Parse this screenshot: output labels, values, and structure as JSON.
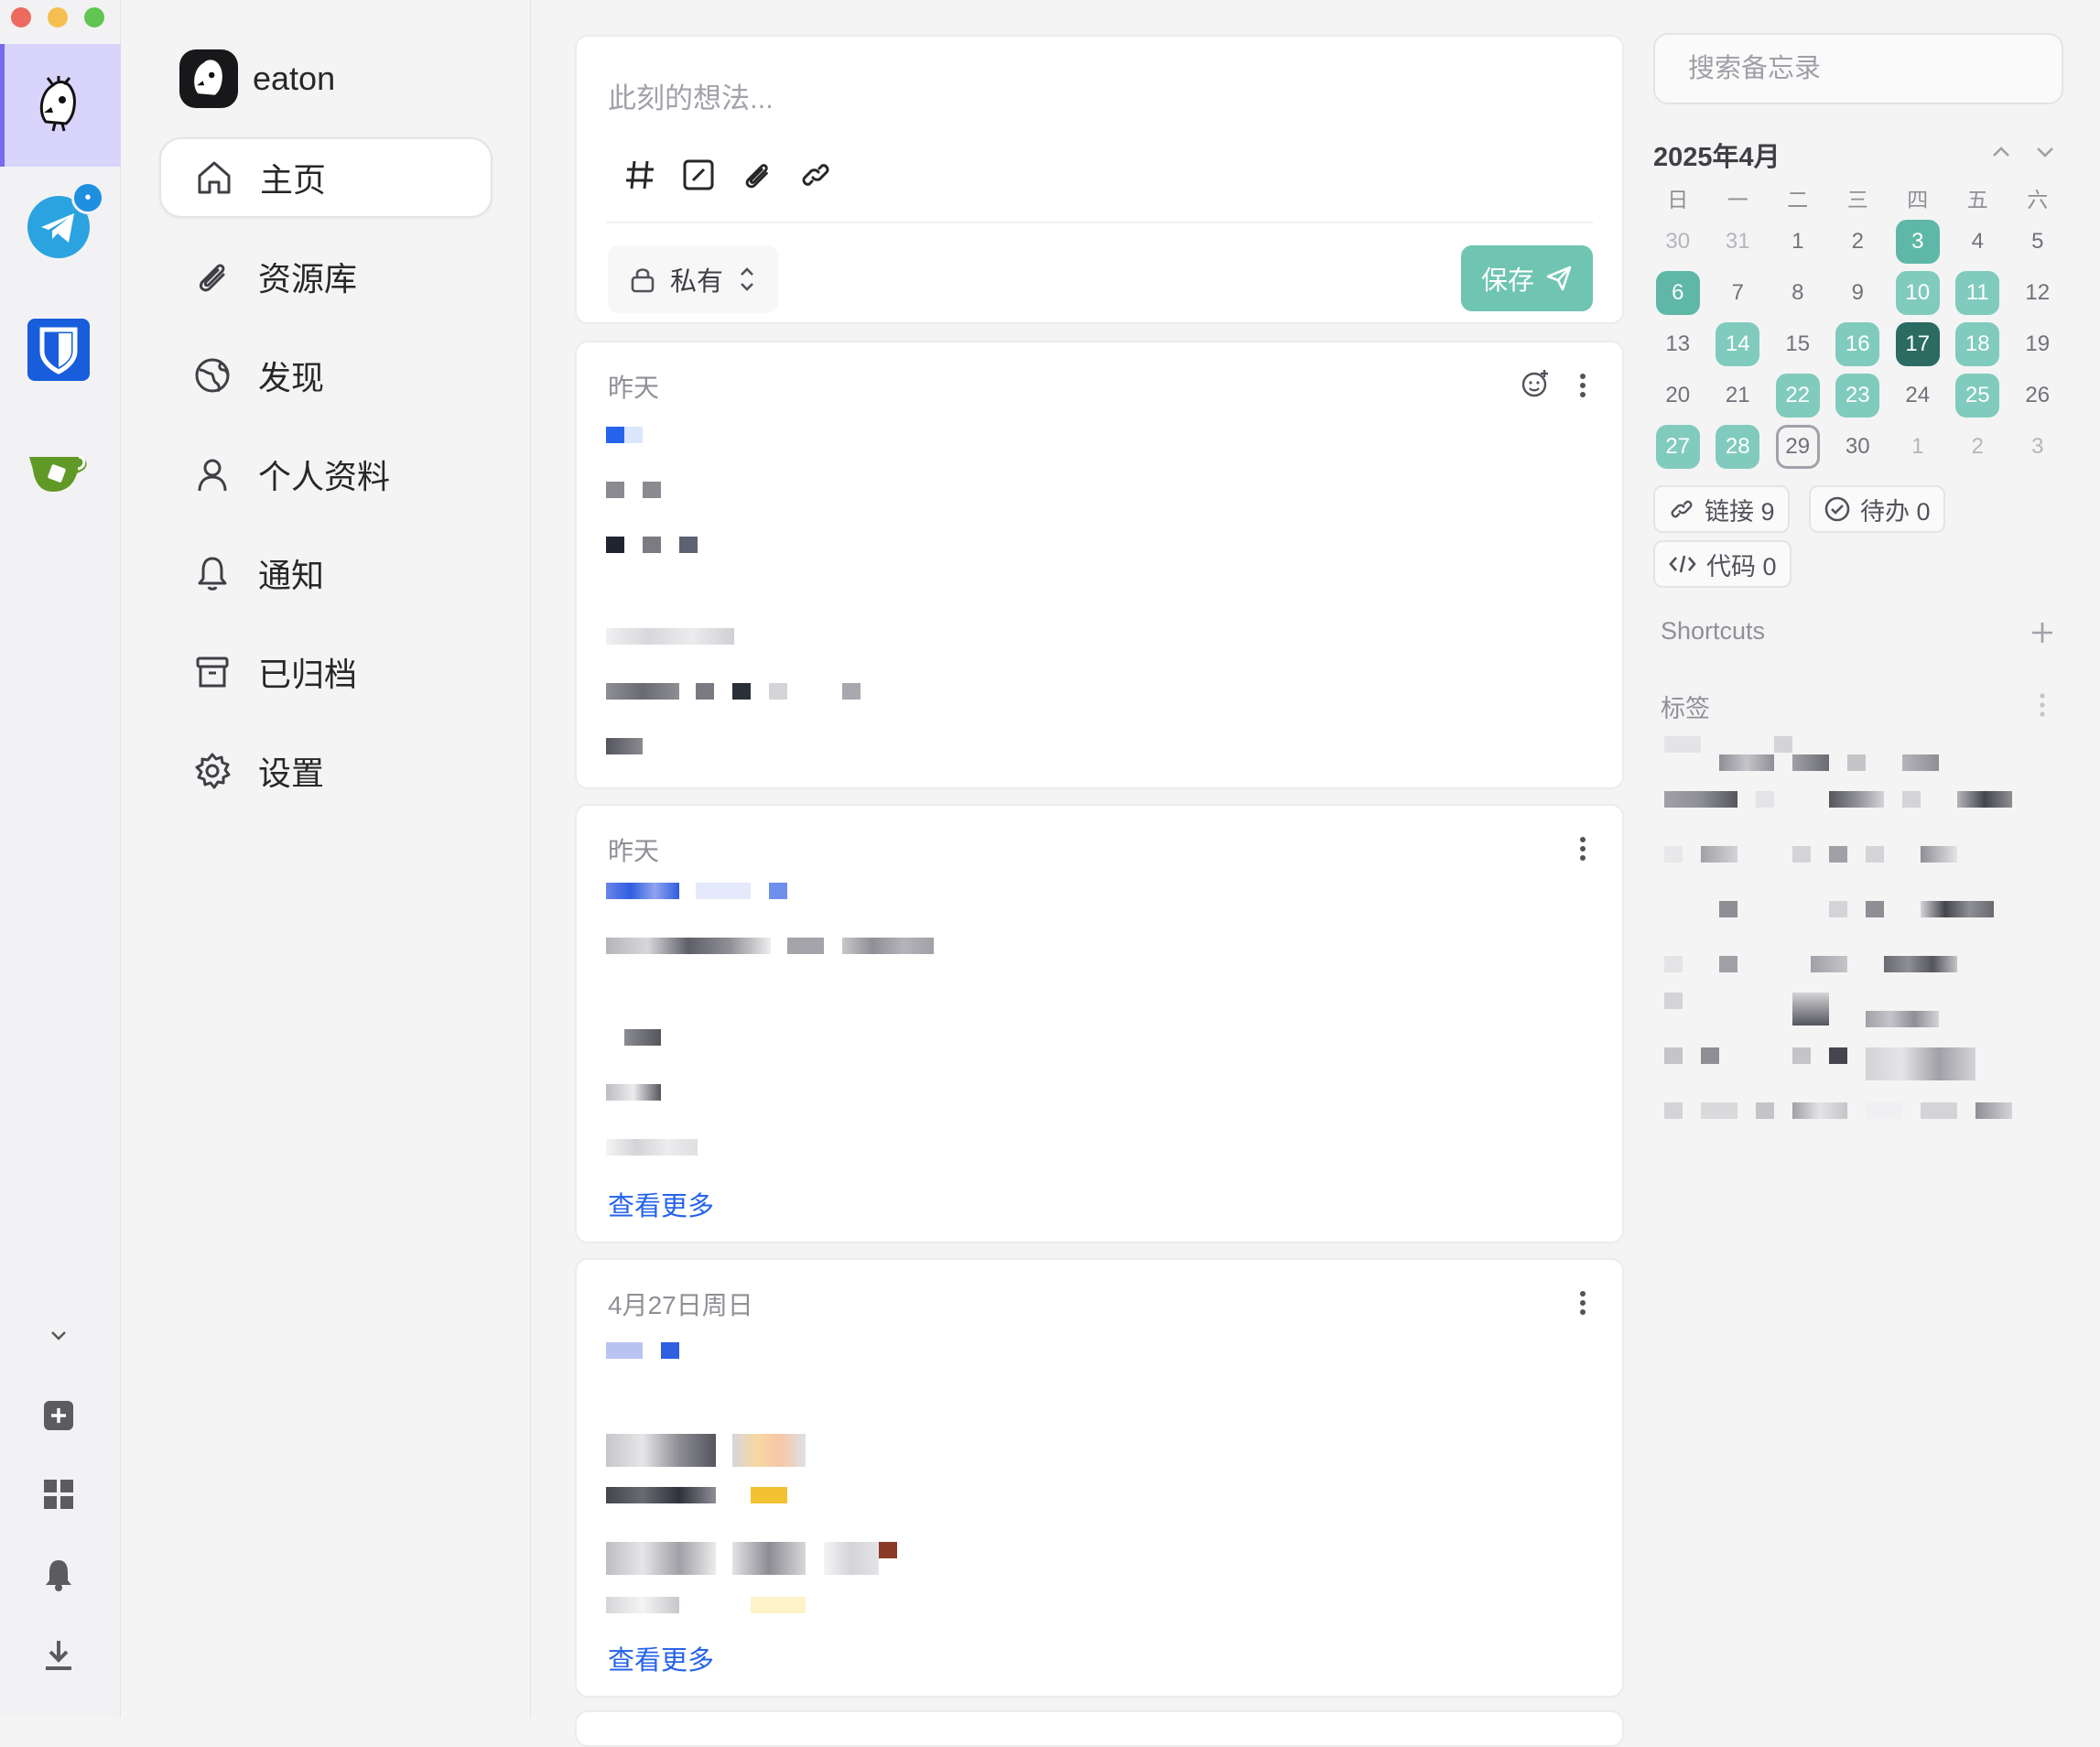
{
  "user": {
    "name": "eaton"
  },
  "nav": {
    "items": [
      {
        "label": "主页",
        "icon": "home-icon"
      },
      {
        "label": "资源库",
        "icon": "paperclip-icon"
      },
      {
        "label": "发现",
        "icon": "globe-icon"
      },
      {
        "label": "个人资料",
        "icon": "user-icon"
      },
      {
        "label": "通知",
        "icon": "bell-icon"
      },
      {
        "label": "已归档",
        "icon": "archive-icon"
      },
      {
        "label": "设置",
        "icon": "gear-icon"
      }
    ],
    "active": "主页"
  },
  "dock": {
    "apps": [
      "memos-app-icon",
      "telegram-icon",
      "bitwarden-icon",
      "gitea-icon"
    ],
    "telegram_badge": "•"
  },
  "editor": {
    "placeholder": "此刻的想法...",
    "tools": [
      "hashtag-icon",
      "checkbox-icon",
      "attachment-icon",
      "link-icon"
    ],
    "visibility": "私有",
    "save_label": "保存"
  },
  "memos": [
    {
      "date": "昨天",
      "has_reaction_button": true,
      "see_more": ""
    },
    {
      "date": "昨天",
      "has_reaction_button": false,
      "see_more": "查看更多"
    },
    {
      "date": "4月27日周日",
      "has_reaction_button": false,
      "see_more": "查看更多"
    }
  ],
  "search": {
    "placeholder": "搜索备忘录"
  },
  "calendar": {
    "title": "2025年4月",
    "weekdays": [
      "日",
      "一",
      "二",
      "三",
      "四",
      "五",
      "六"
    ],
    "days": [
      {
        "d": "30",
        "muted": true,
        "lvl": 0
      },
      {
        "d": "31",
        "muted": true,
        "lvl": 0
      },
      {
        "d": "1",
        "lvl": 0
      },
      {
        "d": "2",
        "lvl": 0
      },
      {
        "d": "3",
        "lvl": 2
      },
      {
        "d": "4",
        "lvl": 0
      },
      {
        "d": "5",
        "lvl": 0
      },
      {
        "d": "6",
        "lvl": 2
      },
      {
        "d": "7",
        "lvl": 0
      },
      {
        "d": "8",
        "lvl": 0
      },
      {
        "d": "9",
        "lvl": 0
      },
      {
        "d": "10",
        "lvl": 1
      },
      {
        "d": "11",
        "lvl": 1
      },
      {
        "d": "12",
        "lvl": 0
      },
      {
        "d": "13",
        "lvl": 0
      },
      {
        "d": "14",
        "lvl": 1
      },
      {
        "d": "15",
        "lvl": 0
      },
      {
        "d": "16",
        "lvl": 1
      },
      {
        "d": "17",
        "lvl": 3
      },
      {
        "d": "18",
        "lvl": 1
      },
      {
        "d": "19",
        "lvl": 0
      },
      {
        "d": "20",
        "lvl": 0
      },
      {
        "d": "21",
        "lvl": 0
      },
      {
        "d": "22",
        "lvl": 1
      },
      {
        "d": "23",
        "lvl": 1
      },
      {
        "d": "24",
        "lvl": 0
      },
      {
        "d": "25",
        "lvl": 1
      },
      {
        "d": "26",
        "lvl": 0
      },
      {
        "d": "27",
        "lvl": 1
      },
      {
        "d": "28",
        "lvl": 1
      },
      {
        "d": "29",
        "today": true,
        "lvl": 0
      },
      {
        "d": "30",
        "lvl": 0
      },
      {
        "d": "1",
        "muted": true,
        "lvl": 0
      },
      {
        "d": "2",
        "muted": true,
        "lvl": 0
      },
      {
        "d": "3",
        "muted": true,
        "lvl": 0
      }
    ]
  },
  "stats": {
    "links": "链接 9",
    "todos": "待办 0",
    "code": "代码 0"
  },
  "shortcuts": {
    "title": "Shortcuts"
  },
  "tags": {
    "title": "标签"
  },
  "colors": {
    "accent": "#6fc4b2",
    "link": "#2563eb",
    "today_dark": "#2b6b62"
  }
}
